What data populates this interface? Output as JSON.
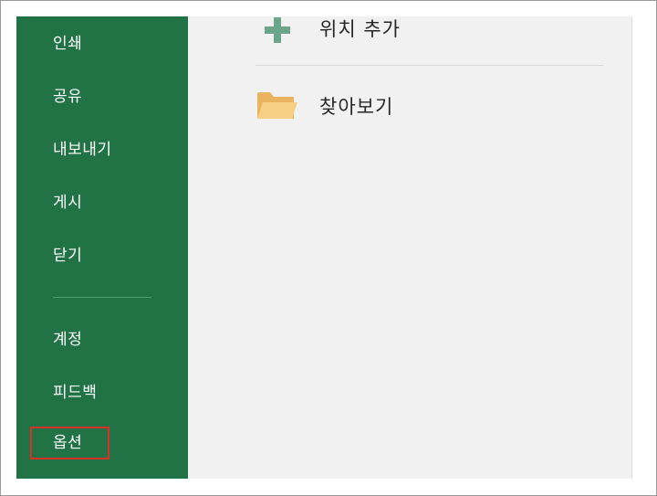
{
  "sidebar": {
    "items": [
      {
        "label": "인쇄"
      },
      {
        "label": "공유"
      },
      {
        "label": "내보내기"
      },
      {
        "label": "게시"
      },
      {
        "label": "닫기"
      }
    ],
    "bottom_items": [
      {
        "label": "계정"
      },
      {
        "label": "피드백"
      },
      {
        "label": "옵션"
      }
    ],
    "highlighted_item": "옵션"
  },
  "main": {
    "add_location": {
      "label": "위치 추가",
      "icon": "plus-icon"
    },
    "browse": {
      "label": "찾아보기",
      "icon": "folder-icon"
    }
  },
  "colors": {
    "sidebar_bg": "#217346",
    "content_bg": "#f1f1f1",
    "highlight_border": "#d9302a",
    "plus_icon": "#6aa58a",
    "folder_icon": "#f3c77a"
  }
}
